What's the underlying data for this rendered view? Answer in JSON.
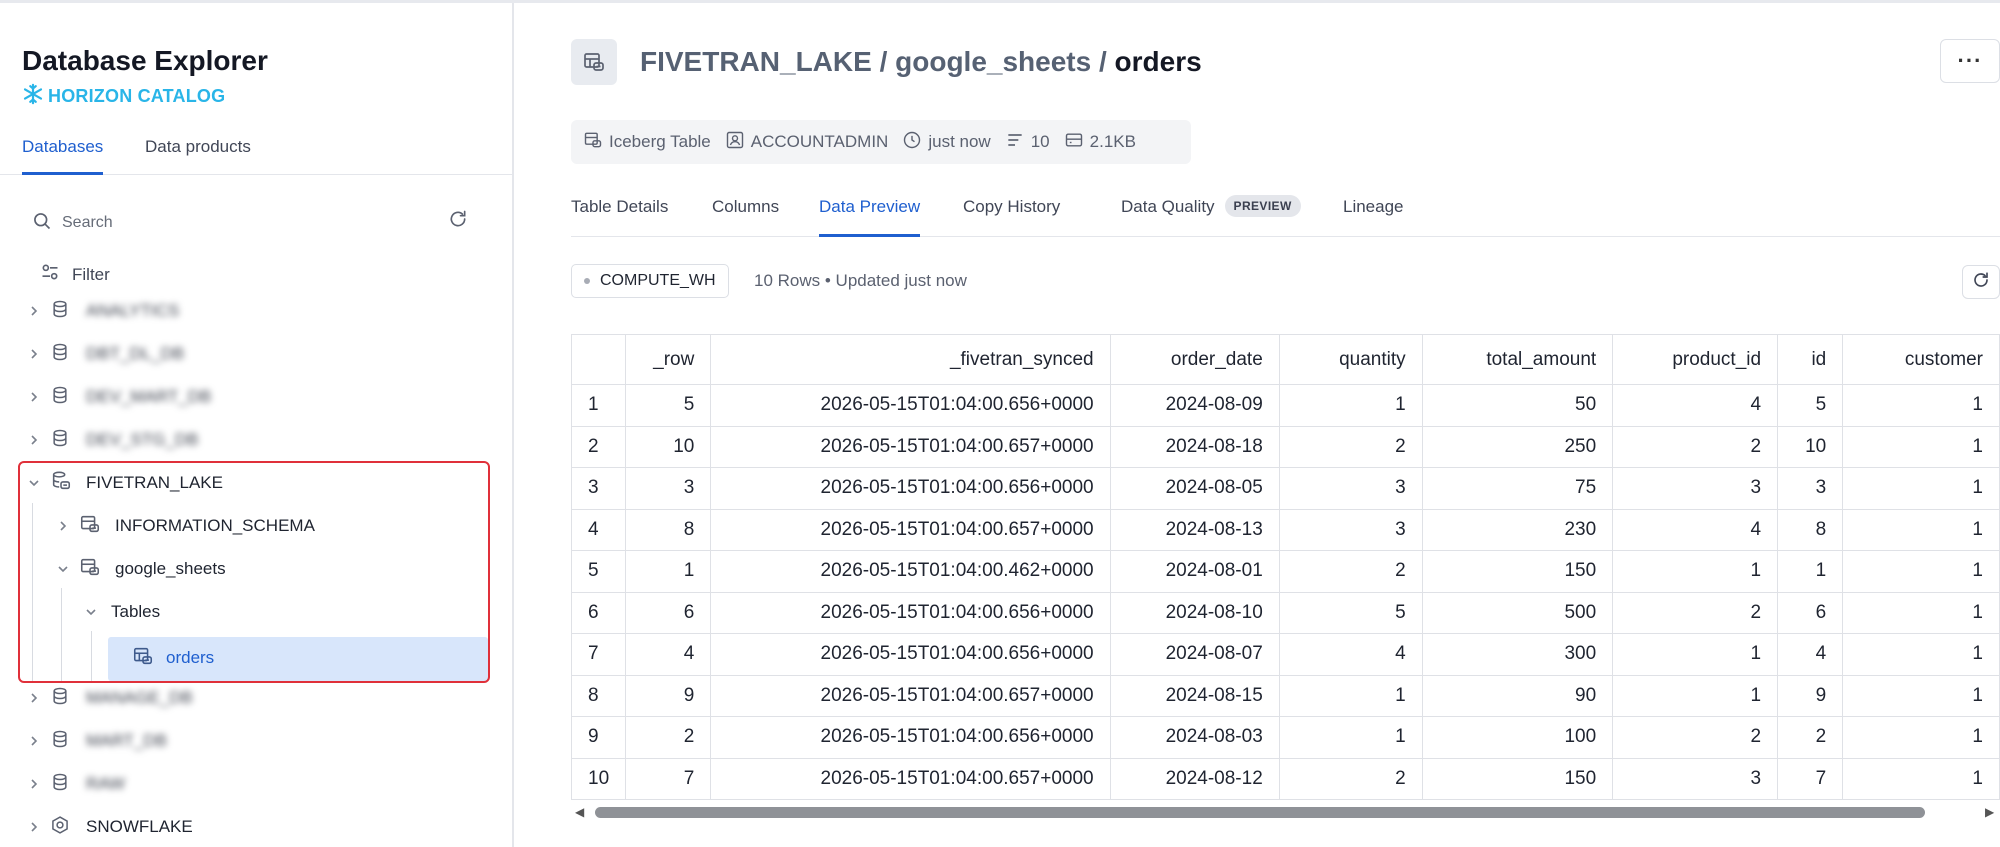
{
  "sidebar": {
    "title": "Database Explorer",
    "brand": "HORIZON CATALOG",
    "tabs": [
      {
        "label": "Databases",
        "active": true
      },
      {
        "label": "Data products",
        "active": false
      }
    ],
    "search_placeholder": "Search",
    "filter_label": "Filter",
    "tree": [
      {
        "label": "ANALYTICS",
        "blurred": true,
        "icon": "database-icon"
      },
      {
        "label": "DBT_DL_DB",
        "blurred": true,
        "icon": "database-icon"
      },
      {
        "label": "DEV_MART_DB",
        "blurred": true,
        "icon": "database-icon"
      },
      {
        "label": "DEV_STG_DB",
        "blurred": true,
        "icon": "database-icon"
      },
      {
        "label": "FIVETRAN_LAKE",
        "blurred": false,
        "icon": "catalog-db-icon"
      },
      {
        "label": "INFORMATION_SCHEMA",
        "blurred": false,
        "icon": "schema-icon"
      },
      {
        "label": "google_sheets",
        "blurred": false,
        "icon": "schema-icon"
      },
      {
        "label": "Tables",
        "blurred": false,
        "icon": ""
      },
      {
        "label": "orders",
        "blurred": false,
        "icon": "iceberg-table-icon"
      },
      {
        "label": "MANAGE_DB",
        "blurred": true,
        "icon": "database-icon"
      },
      {
        "label": "MART_DB",
        "blurred": true,
        "icon": "database-icon"
      },
      {
        "label": "RAW",
        "blurred": true,
        "icon": "database-icon"
      },
      {
        "label": "SNOWFLAKE",
        "blurred": false,
        "icon": "snowflake-db-icon"
      }
    ]
  },
  "header": {
    "path_db": "FIVETRAN_LAKE",
    "path_schema": "google_sheets",
    "path_table": "orders",
    "sep": " / ",
    "more": "···"
  },
  "meta": {
    "type": "Iceberg Table",
    "owner": "ACCOUNTADMIN",
    "updated": "just now",
    "rows": "10",
    "size": "2.1KB"
  },
  "tabs": [
    {
      "label": "Table Details",
      "active": false
    },
    {
      "label": "Columns",
      "active": false
    },
    {
      "label": "Data Preview",
      "active": true
    },
    {
      "label": "Copy History",
      "active": false
    },
    {
      "label": "Data Quality",
      "active": false,
      "badge": "PREVIEW"
    },
    {
      "label": "Lineage",
      "active": false
    }
  ],
  "preview": {
    "warehouse": "COMPUTE_WH",
    "info": "10 Rows • Updated just now"
  },
  "table": {
    "columns": [
      "",
      "_row",
      "_fivetran_synced",
      "order_date",
      "quantity",
      "total_amount",
      "product_id",
      "id",
      "customer"
    ],
    "rows": [
      [
        "1",
        "5",
        "2026-05-15T01:04:00.656+0000",
        "2024-08-09",
        "1",
        "50",
        "4",
        "5",
        "1"
      ],
      [
        "2",
        "10",
        "2026-05-15T01:04:00.657+0000",
        "2024-08-18",
        "2",
        "250",
        "2",
        "10",
        "1"
      ],
      [
        "3",
        "3",
        "2026-05-15T01:04:00.656+0000",
        "2024-08-05",
        "3",
        "75",
        "3",
        "3",
        "1"
      ],
      [
        "4",
        "8",
        "2026-05-15T01:04:00.657+0000",
        "2024-08-13",
        "3",
        "230",
        "4",
        "8",
        "1"
      ],
      [
        "5",
        "1",
        "2026-05-15T01:04:00.462+0000",
        "2024-08-01",
        "2",
        "150",
        "1",
        "1",
        "1"
      ],
      [
        "6",
        "6",
        "2026-05-15T01:04:00.656+0000",
        "2024-08-10",
        "5",
        "500",
        "2",
        "6",
        "1"
      ],
      [
        "7",
        "4",
        "2026-05-15T01:04:00.656+0000",
        "2024-08-07",
        "4",
        "300",
        "1",
        "4",
        "1"
      ],
      [
        "8",
        "9",
        "2026-05-15T01:04:00.657+0000",
        "2024-08-15",
        "1",
        "90",
        "1",
        "9",
        "1"
      ],
      [
        "9",
        "2",
        "2026-05-15T01:04:00.656+0000",
        "2024-08-03",
        "1",
        "100",
        "2",
        "2",
        "1"
      ],
      [
        "10",
        "7",
        "2026-05-15T01:04:00.657+0000",
        "2024-08-12",
        "2",
        "150",
        "3",
        "7",
        "1"
      ]
    ]
  },
  "colors": {
    "accent": "#1f5fcf",
    "brand": "#29b5e8",
    "highlight": "#e0303a",
    "selected": "#d8e6fb"
  }
}
